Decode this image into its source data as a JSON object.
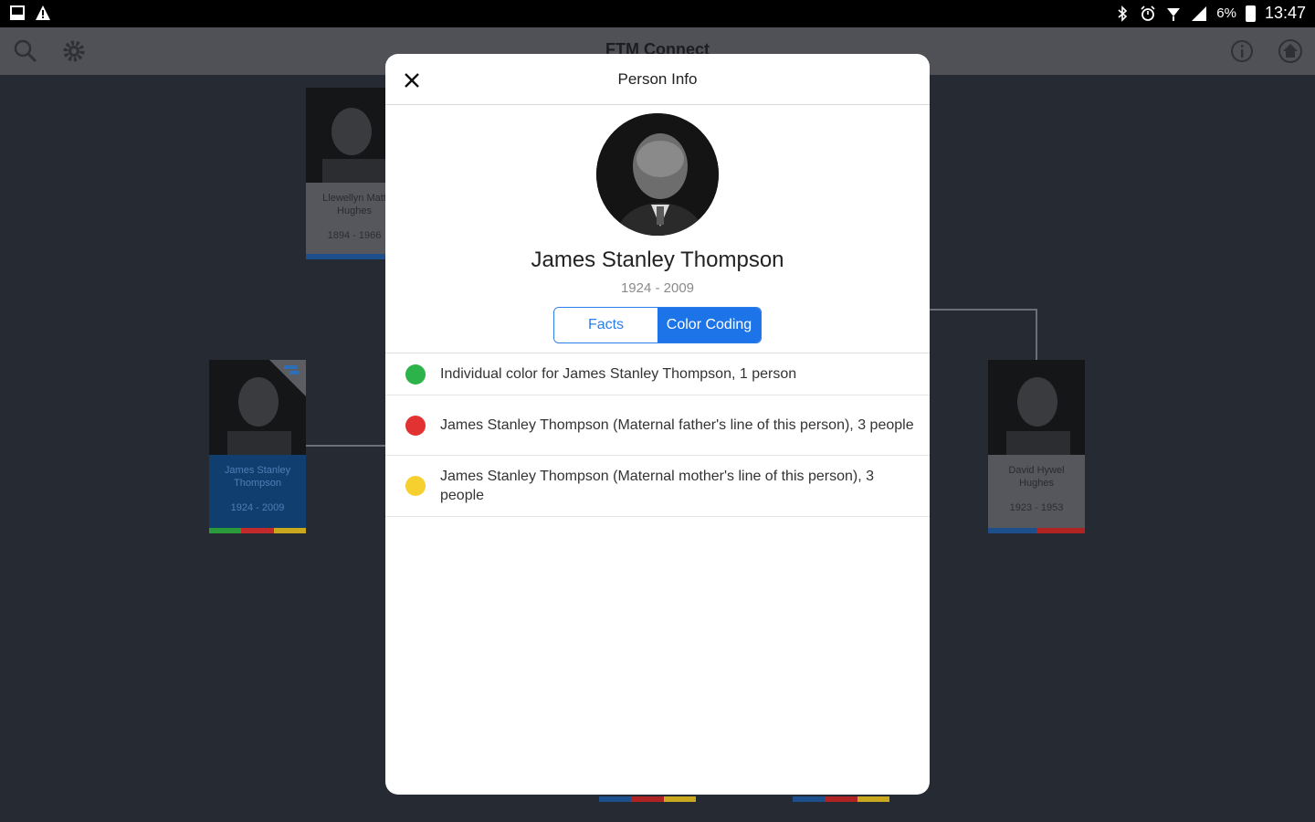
{
  "statusbar": {
    "time": "13:47",
    "battery_text": "6%",
    "icons": [
      "gallery-icon",
      "warning-icon",
      "bluetooth-icon",
      "alarm-icon",
      "wifi-icon",
      "signal-icon",
      "battery-icon"
    ]
  },
  "appbar": {
    "title": "FTM Connect",
    "icons": [
      "search-icon",
      "gear-icon",
      "info-icon",
      "home-icon"
    ]
  },
  "tree": {
    "cards": [
      {
        "name": "Llewellyn Matt Hughes",
        "dates": "1894 - 1966",
        "colors": [
          "#1d4f8c"
        ]
      },
      {
        "name": "James Stanley Thompson",
        "dates": "1924 - 2009",
        "colors": [
          "#2a9a3a",
          "#c02a2a",
          "#c9a81d"
        ],
        "selected": true
      },
      {
        "name": "David Hywel Hughes",
        "dates": "1923 - 1953",
        "colors": [
          "#1d4f8c",
          "#b02323"
        ]
      }
    ]
  },
  "dialog": {
    "title": "Person Info",
    "close_label": "✕",
    "person_name": "James Stanley Thompson",
    "person_dates": "1924 - 2009",
    "tabs": [
      {
        "label": "Facts",
        "active": false
      },
      {
        "label": "Color Coding",
        "active": true
      }
    ],
    "color_coding": [
      {
        "color": "#2cb34a",
        "text": "Individual color for James Stanley Thompson, 1 person"
      },
      {
        "color": "#e23232",
        "text": "James Stanley Thompson (Maternal father's line of this person), 3 people"
      },
      {
        "color": "#f6d02f",
        "text": "James Stanley Thompson (Maternal mother's line of this person), 3 people"
      }
    ]
  }
}
